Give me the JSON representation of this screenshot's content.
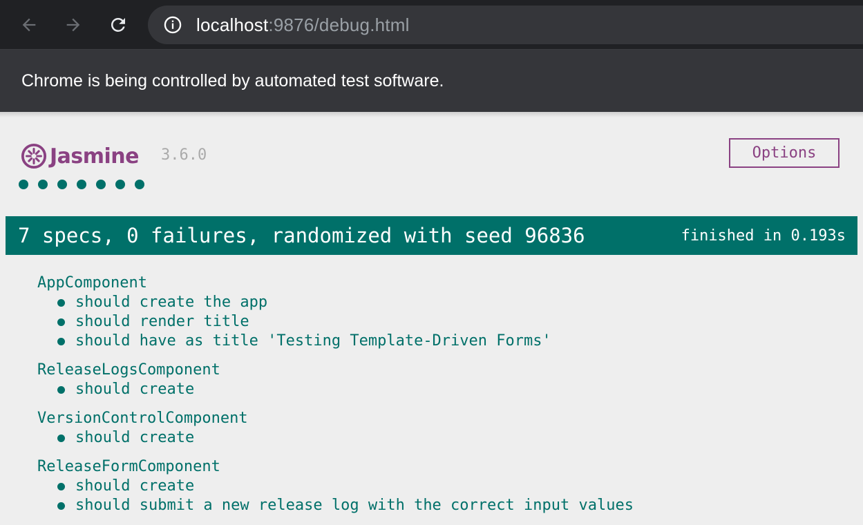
{
  "browser": {
    "url_host": "localhost",
    "url_path": ":9876/debug.html",
    "infobar_text": "Chrome is being controlled by automated test software."
  },
  "jasmine": {
    "logo_text": "Jasmine",
    "version": "3.6.0",
    "options_label": "Options",
    "summary": "7 specs, 0 failures, randomized with seed 96836",
    "finished": "finished in 0.193s",
    "suites": [
      {
        "name": "AppComponent",
        "specs": [
          "should create the app",
          "should render title",
          "should have as title 'Testing Template-Driven Forms'"
        ]
      },
      {
        "name": "ReleaseLogsComponent",
        "specs": [
          "should create"
        ]
      },
      {
        "name": "VersionControlComponent",
        "specs": [
          "should create"
        ]
      },
      {
        "name": "ReleaseFormComponent",
        "specs": [
          "should create",
          "should submit a new release log with the correct input values"
        ]
      }
    ]
  },
  "colors": {
    "jasmine_purple": "#8a4182",
    "passed_green": "#007069",
    "toolbar_bg": "#202124",
    "infobar_bg": "#35363a"
  }
}
